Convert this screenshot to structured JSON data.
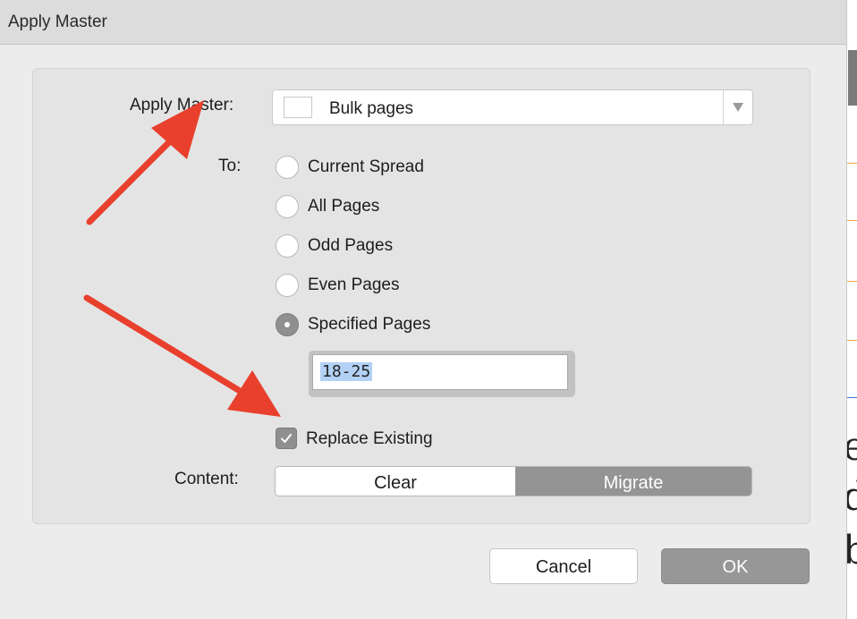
{
  "window": {
    "title": "Apply Master"
  },
  "master": {
    "label": "Apply Master:",
    "selected": "Bulk pages"
  },
  "to": {
    "label": "To:",
    "options": [
      {
        "label": "Current Spread",
        "checked": false
      },
      {
        "label": "All Pages",
        "checked": false
      },
      {
        "label": "Odd Pages",
        "checked": false
      },
      {
        "label": "Even Pages",
        "checked": false
      },
      {
        "label": "Specified Pages",
        "checked": true
      }
    ],
    "specified_pages_value": "18-25"
  },
  "replace_existing": {
    "label": "Replace Existing",
    "checked": true
  },
  "content": {
    "label": "Content:",
    "segments": [
      "Clear",
      "Migrate"
    ],
    "selected": "Migrate"
  },
  "buttons": {
    "cancel": "Cancel",
    "ok": "OK"
  },
  "colors": {
    "annotation_arrow": "#e8402d",
    "selection_highlight": "#b3d1f5",
    "selected_control": "#949494"
  }
}
